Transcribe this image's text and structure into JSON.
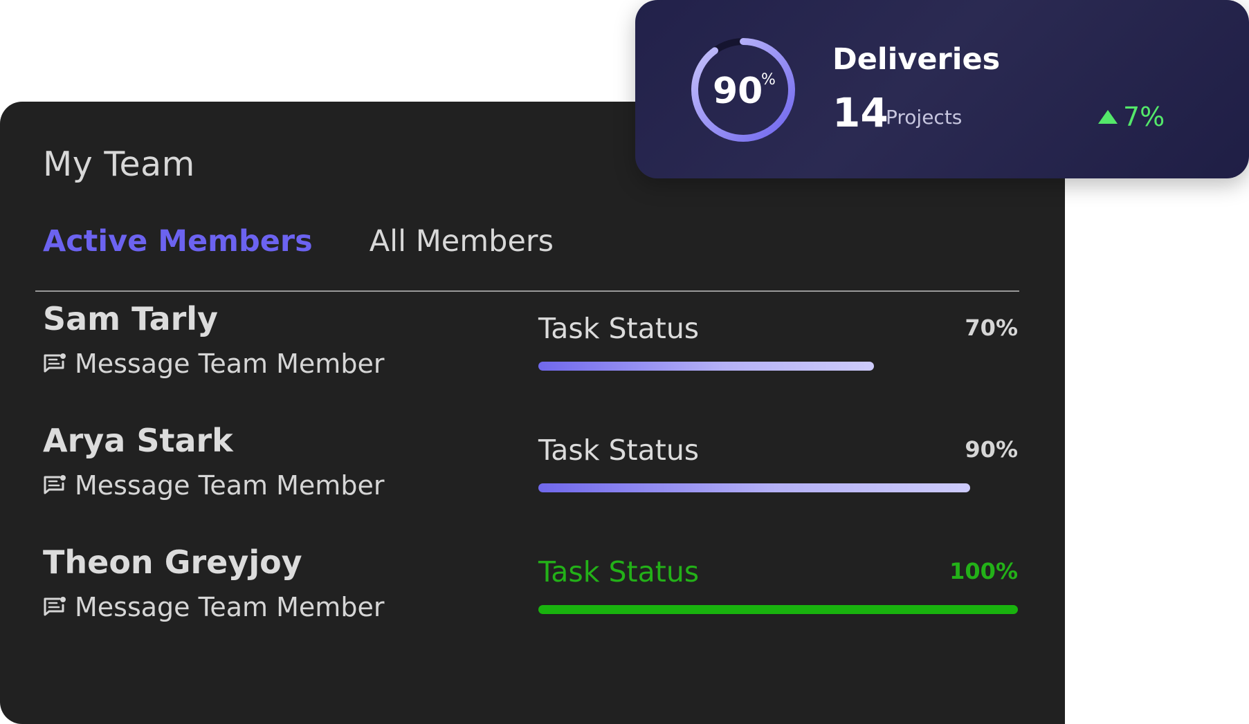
{
  "team_card": {
    "title": "My Team",
    "tabs": [
      {
        "label": "Active Members",
        "active": true
      },
      {
        "label": "All Members",
        "active": false
      }
    ],
    "members": [
      {
        "name": "Sam Tarly",
        "message_label": "Message Team Member",
        "status_label": "Task Status",
        "progress_text": "70%",
        "progress": 70
      },
      {
        "name": "Arya Stark",
        "message_label": "Message Team Member",
        "status_label": "Task Status",
        "progress_text": "90%",
        "progress": 90
      },
      {
        "name": "Theon Greyjoy",
        "message_label": "Message Team Member",
        "status_label": "Task Status",
        "progress_text": "100%",
        "progress": 100
      }
    ]
  },
  "deliveries": {
    "ring_value": "90",
    "ring_unit": "%",
    "ring_progress": 90,
    "title": "Deliveries",
    "count": "14",
    "count_unit": "Projects",
    "trend": "7%",
    "trend_icon": "triangle-up-icon"
  },
  "colors": {
    "card_bg": "#212121",
    "accent": "#6c63f0",
    "success": "#19b30e",
    "trend_up": "#54e86a",
    "deliveries_bg": "#22214a"
  }
}
